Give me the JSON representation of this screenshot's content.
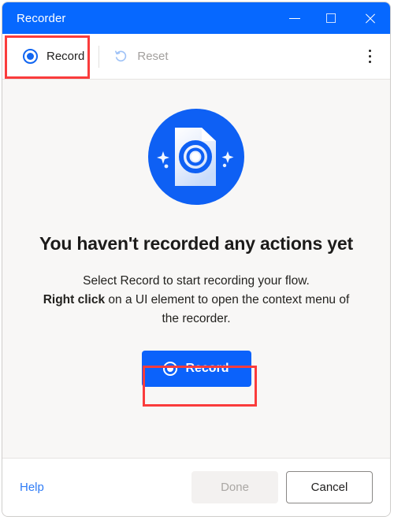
{
  "window": {
    "title": "Recorder",
    "accent_color": "#0668ff",
    "body_color": "#f8f7f6",
    "controls": {
      "minimize": "minimize",
      "maximize": "maximize",
      "close": "close"
    }
  },
  "toolbar": {
    "record_label": "Record",
    "reset_label": "Reset",
    "reset_disabled": true,
    "overflow_label": "more-options"
  },
  "main": {
    "illustration": "document-with-record-target",
    "headline": "You haven't recorded any actions yet",
    "body_line1": "Select Record to start recording your flow.",
    "body_bold": "Right click",
    "body_line2_rest": " on a UI element to open the context menu of the recorder.",
    "record_button_label": "Record"
  },
  "footer": {
    "help_label": "Help",
    "done_label": "Done",
    "done_disabled": true,
    "cancel_label": "Cancel"
  },
  "annotations": {
    "highlight_color": "#fa3c3c",
    "boxes": [
      "toolbar-record",
      "primary-record-button"
    ]
  }
}
